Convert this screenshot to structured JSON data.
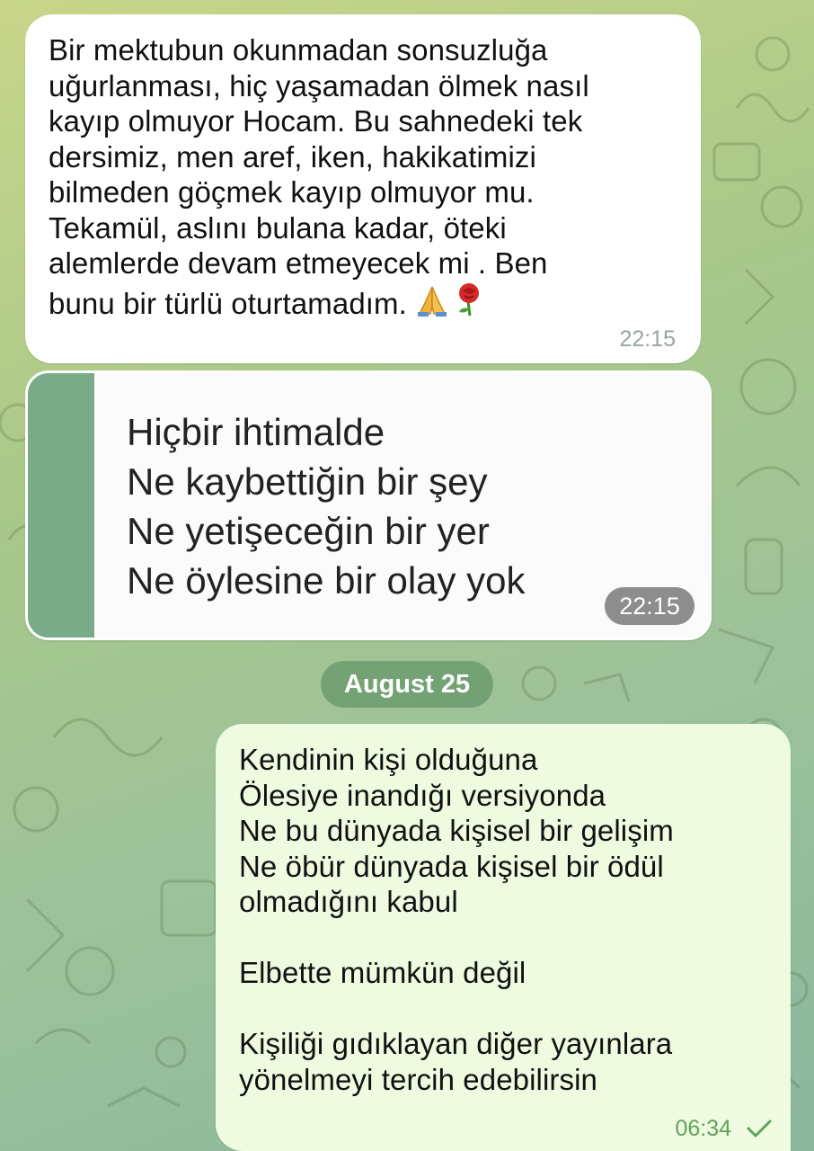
{
  "messages": [
    {
      "text": "Bir mektubun okunmadan sonsuzluğa\nuğurlanması,  hiç yaşamadan ölmek nasıl\nkayıp olmuyor Hocam. Bu sahnedeki tek\ndersimiz, men aref, iken, hakikatimizi\nbilmeden göçmek kayıp olmuyor mu.\nTekamül, aslını bulana kadar,  öteki\nalemlerde devam etmeyecek mi . Ben\nbunu bir türlü oturtamadım.",
      "emojis": [
        "folded-hands-icon",
        "rose-icon"
      ],
      "time": "22:15"
    },
    {
      "image_lines": [
        "Hiçbir ihtimalde",
        "Ne kaybettiğin bir şey",
        "Ne yetişeceğin bir yer",
        "Ne öylesine bir olay yok"
      ],
      "time": "22:15"
    },
    {
      "text": "Kendinin kişi olduğuna\nÖlesiye inandığı versiyonda\nNe bu dünyada kişisel bir gelişim\nNe öbür dünyada kişisel bir ödül\nolmadığını kabul\n\nElbette mümkün değil\n\nKişiliği gıdıklayan diğer yayınlara\nyönelmeyi tercih edebilirsin",
      "time": "06:34",
      "status_icon": "check-icon"
    }
  ],
  "date_separator": "August 25",
  "colors": {
    "incoming_bubble": "#ffffff",
    "outgoing_bubble": "#eefbe0",
    "outgoing_time": "#5fa35c",
    "incoming_time": "#9aa3a6",
    "date_pill": "#588c5f"
  }
}
